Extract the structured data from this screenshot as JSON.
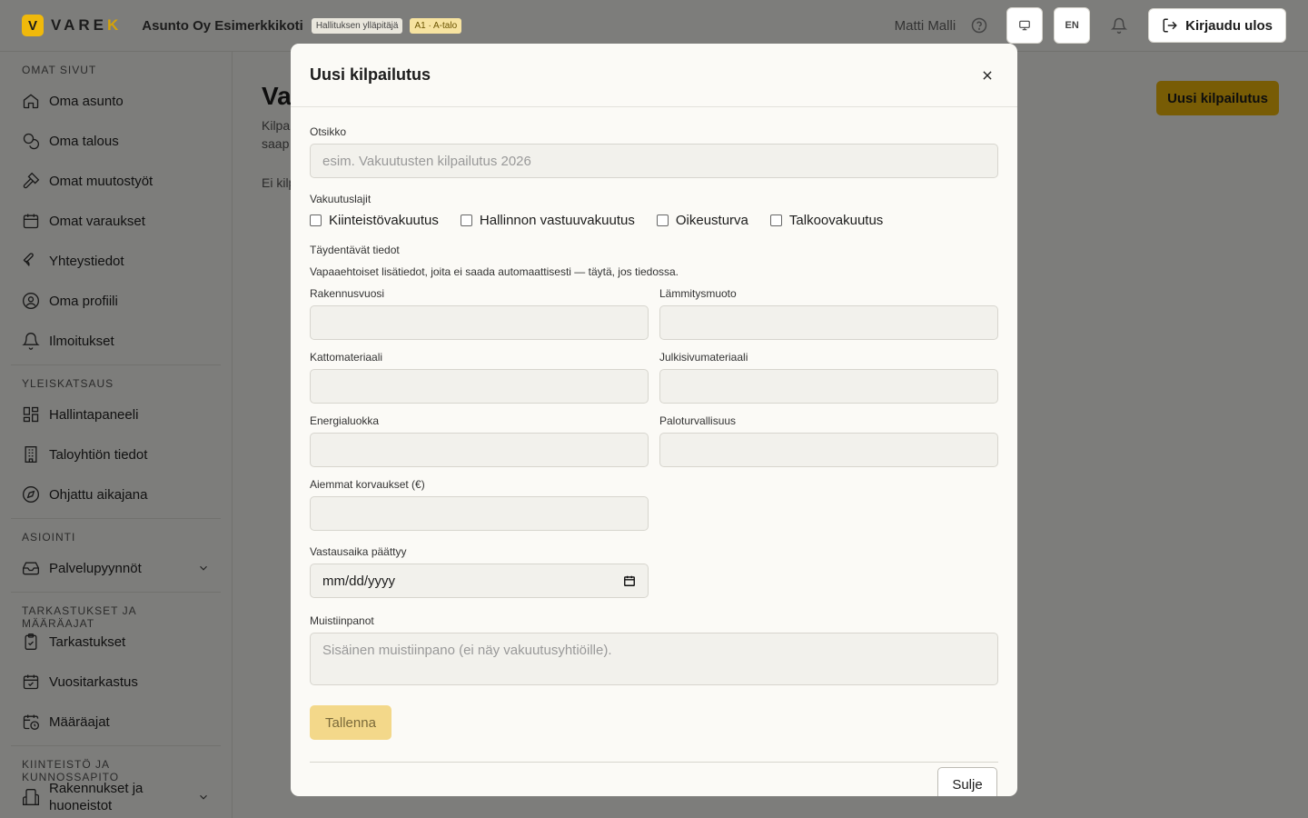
{
  "header": {
    "logo_letter": "V",
    "logo_text_main": "VARE",
    "logo_text_accent": "K",
    "org_name": "Asunto Oy Esimerkkikoti",
    "role_badge": "Hallituksen ylläpitäjä",
    "apartment_badge": "A1 · A-talo",
    "username": "Matti Malli",
    "language": "EN",
    "logout_label": "Kirjaudu ulos"
  },
  "sidebar": {
    "sections": [
      {
        "title": "OMAT SIVUT",
        "items": [
          {
            "label": "Oma asunto",
            "icon": "home-icon"
          },
          {
            "label": "Oma talous",
            "icon": "coins-icon"
          },
          {
            "label": "Omat muutostyöt",
            "icon": "hammer-icon"
          },
          {
            "label": "Omat varaukset",
            "icon": "calendar-icon"
          },
          {
            "label": "Yhteystiedot",
            "icon": "wrench-icon"
          },
          {
            "label": "Oma profiili",
            "icon": "user-circle-icon"
          },
          {
            "label": "Ilmoitukset",
            "icon": "bell-icon"
          }
        ]
      },
      {
        "title": "YLEISKATSAUS",
        "items": [
          {
            "label": "Hallintapaneeli",
            "icon": "dashboard-icon"
          },
          {
            "label": "Taloyhtiön tiedot",
            "icon": "building-icon"
          },
          {
            "label": "Ohjattu aikajana",
            "icon": "compass-icon"
          }
        ]
      },
      {
        "title": "ASIOINTI",
        "items": [
          {
            "label": "Palvelupyynnöt",
            "icon": "inbox-icon",
            "expandable": true
          }
        ]
      },
      {
        "title": "TARKASTUKSET JA MÄÄRÄAJAT",
        "items": [
          {
            "label": "Tarkastukset",
            "icon": "clipboard-check-icon"
          },
          {
            "label": "Vuositarkastus",
            "icon": "calendar-check-icon"
          },
          {
            "label": "Määräajat",
            "icon": "calendar-clock-icon"
          }
        ]
      },
      {
        "title": "KIINTEISTÖ JA KUNNOSSAPITO",
        "items": [
          {
            "label": "Rakennukset ja huoneistot",
            "icon": "building-icon",
            "expandable": true
          }
        ]
      }
    ]
  },
  "main": {
    "title": "Va",
    "desc_line1": "Kilpa",
    "desc_line2": "saap",
    "empty_text": "Ei kilp",
    "new_button": "Uusi kilpailutus"
  },
  "modal": {
    "title": "Uusi kilpailutus",
    "title_field": {
      "label": "Otsikko",
      "placeholder": "esim. Vakuutusten kilpailutus 2026"
    },
    "insurance_types_label": "Vakuutuslajit",
    "insurance_types": [
      "Kiinteistövakuutus",
      "Hallinnon vastuuvakuutus",
      "Oikeusturva",
      "Talkoovakuutus"
    ],
    "extra_title": "Täydentävät tiedot",
    "extra_hint": "Vapaaehtoiset lisätiedot, joita ei saada automaattisesti — täytä, jos tiedossa.",
    "fields": {
      "build_year": "Rakennusvuosi",
      "heating": "Lämmitysmuoto",
      "roof": "Kattomateriaali",
      "facade": "Julkisivumateriaali",
      "energy": "Energialuokka",
      "fire": "Paloturvallisuus",
      "claims": "Aiemmat korvaukset (€)"
    },
    "deadline": {
      "label": "Vastausaika päättyy",
      "value": "mm/dd/yyyy"
    },
    "notes": {
      "label": "Muistiinpanot",
      "placeholder": "Sisäinen muistiinpano (ei näy vakuutusyhtiöille)."
    },
    "save_label": "Tallenna",
    "close_label": "Sulje"
  },
  "colors": {
    "accent": "#f0b90b",
    "background": "#fbfaf6"
  }
}
